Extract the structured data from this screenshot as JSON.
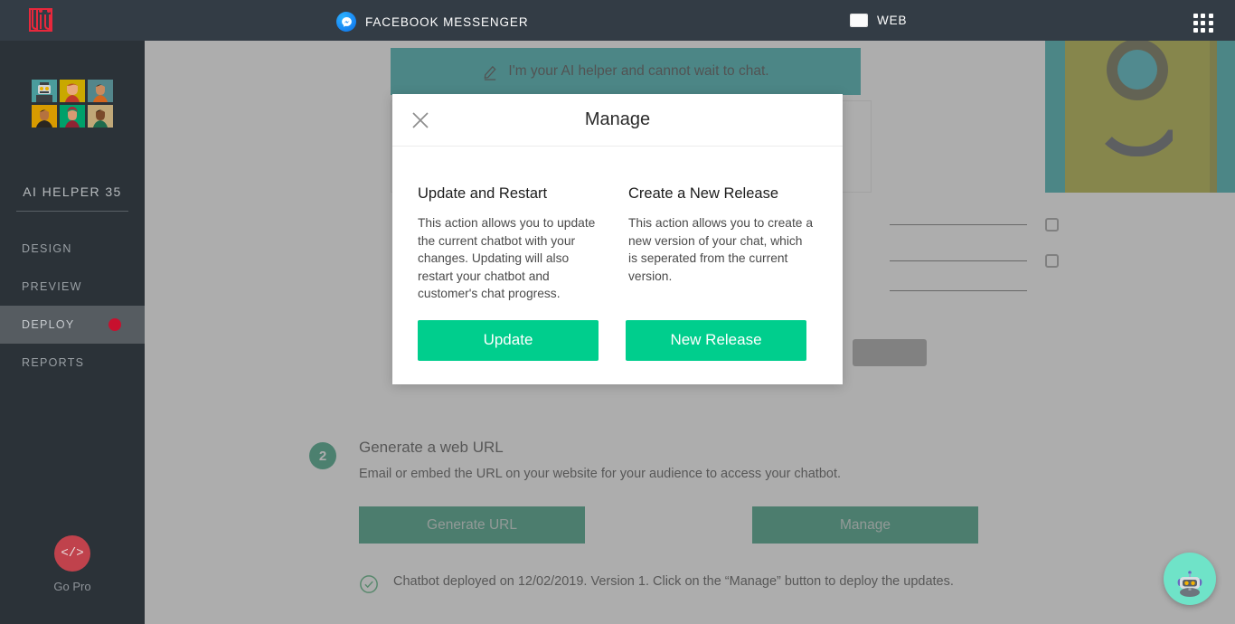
{
  "topbar": {
    "logo_name": "juji-logo",
    "channels": [
      {
        "id": "messenger",
        "label": "FACEBOOK MESSENGER",
        "icon": "messenger-icon"
      },
      {
        "id": "web",
        "label": "WEB",
        "icon": "web-browser-icon"
      }
    ],
    "apps_grid_icon": "apps-grid-icon"
  },
  "sidebar": {
    "bot_name": "AI HELPER 35",
    "avatars": [
      {
        "name": "avatar-robot",
        "bg": "#4a9c9c",
        "skin": "#cfd4d6",
        "hair": "#3c4043"
      },
      {
        "name": "avatar-person-1",
        "bg": "#c9a800",
        "skin": "#e8a87c",
        "hair": "#b9541f"
      },
      {
        "name": "avatar-person-2",
        "bg": "#53868b",
        "skin": "#c98a5e",
        "hair": "#3a2a1c"
      },
      {
        "name": "avatar-person-3",
        "bg": "#d89b00",
        "skin": "#b5723f",
        "hair": "#2a2018"
      },
      {
        "name": "avatar-person-4",
        "bg": "#00a06a",
        "skin": "#d79a72",
        "hair": "#a32b3c"
      },
      {
        "name": "avatar-person-5",
        "bg": "#c0a878",
        "skin": "#7a4a2a",
        "hair": "#231a12"
      }
    ],
    "items": [
      {
        "id": "design",
        "label": "DESIGN",
        "active": false,
        "badge": false
      },
      {
        "id": "preview",
        "label": "PREVIEW",
        "active": false,
        "badge": false
      },
      {
        "id": "deploy",
        "label": "DEPLOY",
        "active": true,
        "badge": true
      },
      {
        "id": "reports",
        "label": "REPORTS",
        "active": false,
        "badge": false
      }
    ],
    "gopro": {
      "icon_text": "</>",
      "label": "Go Pro",
      "color": "#c0424c"
    }
  },
  "hero": {
    "banner_text": "I'm your AI helper and cannot wait to chat.",
    "banner_icon": "pencil-edit-icon",
    "banner_color": "#009a9a",
    "monster_body_color": "#9a9a00",
    "monster_pupil_color": "#0fa3b1"
  },
  "deploy_step": {
    "number": "2",
    "title": "Generate a web URL",
    "subtitle": "Email or embed the URL on your website for your audience to access your chatbot.",
    "buttons": [
      {
        "id": "generate-url",
        "label": "Generate URL"
      },
      {
        "id": "manage",
        "label": "Manage"
      }
    ],
    "status": {
      "icon": "check-circle-icon",
      "text": "Chatbot deployed on 12/02/2019. Version 1. Click on the “Manage” button to deploy the updates."
    }
  },
  "modal": {
    "title": "Manage",
    "close_icon": "close-x-icon",
    "columns": [
      {
        "id": "update-restart",
        "title": "Update and Restart",
        "description": "This action allows you to update the current chatbot with your changes. Updating will also restart your chatbot and customer's chat progress.",
        "button_label": "Update"
      },
      {
        "id": "new-release",
        "title": "Create a New Release",
        "description": "This action allows you to create a new version of your chat, which is seperated from the current version.",
        "button_label": "New Release"
      }
    ],
    "accent_color": "#00ce8d"
  },
  "chat_widget": {
    "icon": "robot-avatar-icon",
    "bg": "#6fe3c8"
  },
  "colors": {
    "topbar": "#333c45",
    "sidebar": "#2b3238",
    "accent_green": "#00ce8d",
    "deploy_green": "#00805a",
    "badge_red": "#c8102e"
  }
}
